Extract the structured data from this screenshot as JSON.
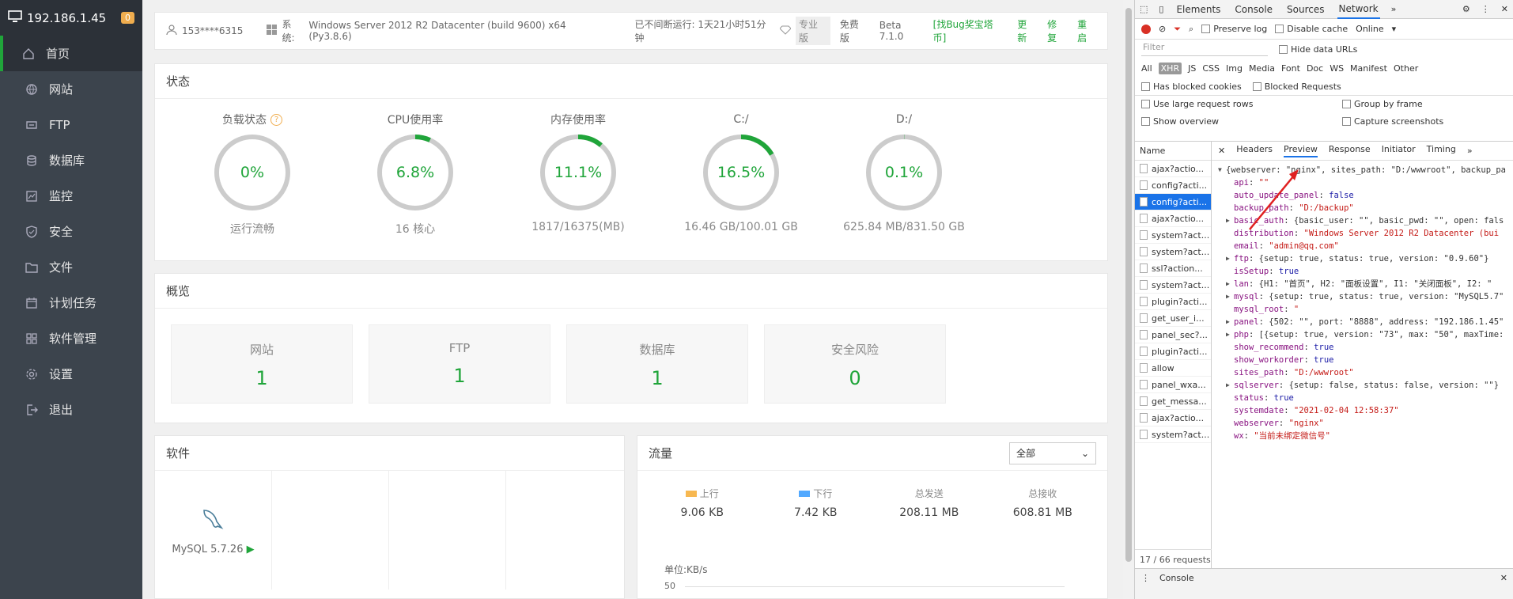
{
  "sidebar": {
    "ip": "192.186.1.45",
    "badge": "0",
    "items": [
      {
        "label": "首页",
        "icon": "home-icon"
      },
      {
        "label": "网站",
        "icon": "globe-icon"
      },
      {
        "label": "FTP",
        "icon": "ftp-icon"
      },
      {
        "label": "数据库",
        "icon": "database-icon"
      },
      {
        "label": "监控",
        "icon": "monitor-icon"
      },
      {
        "label": "安全",
        "icon": "shield-icon"
      },
      {
        "label": "文件",
        "icon": "folder-icon"
      },
      {
        "label": "计划任务",
        "icon": "calendar-icon"
      },
      {
        "label": "软件管理",
        "icon": "apps-icon"
      },
      {
        "label": "设置",
        "icon": "gear-icon"
      },
      {
        "label": "退出",
        "icon": "logout-icon"
      }
    ]
  },
  "topbar": {
    "user": "153****6315",
    "system_label": "系统:",
    "system": "Windows Server 2012 R2 Datacenter (build 9600) x64 (Py3.8.6)",
    "uptime": "已不间断运行: 1天21小时51分钟",
    "pro": "专业版",
    "free": "免费版",
    "version": "Beta 7.1.0",
    "bug": "[找Bug奖宝塔币]",
    "update": "更新",
    "repair": "修复",
    "restart": "重启"
  },
  "status": {
    "title": "状态",
    "gauges": [
      {
        "title": "负载状态",
        "value": "0%",
        "sub": "运行流畅",
        "pct": 0,
        "help": "?"
      },
      {
        "title": "CPU使用率",
        "value": "6.8%",
        "sub": "16 核心",
        "pct": 6.8
      },
      {
        "title": "内存使用率",
        "value": "11.1%",
        "sub": "1817/16375(MB)",
        "pct": 11.1
      },
      {
        "title": "C:/",
        "value": "16.5%",
        "sub": "16.46 GB/100.01 GB",
        "pct": 16.5
      },
      {
        "title": "D:/",
        "value": "0.1%",
        "sub": "625.84 MB/831.50 GB",
        "pct": 0.1
      }
    ],
    "color": "#20a53a"
  },
  "overview": {
    "title": "概览",
    "boxes": [
      {
        "label": "网站",
        "value": "1"
      },
      {
        "label": "FTP",
        "value": "1"
      },
      {
        "label": "数据库",
        "value": "1"
      },
      {
        "label": "安全风险",
        "value": "0"
      }
    ]
  },
  "software": {
    "title": "软件",
    "items": [
      {
        "name": "MySQL 5.7.26"
      }
    ]
  },
  "traffic": {
    "title": "流量",
    "select": "全部",
    "stats": [
      {
        "label": "上行",
        "value": "9.06 KB",
        "color": "#f7b851"
      },
      {
        "label": "下行",
        "value": "7.42 KB",
        "color": "#52a9ff"
      },
      {
        "label": "总发送",
        "value": "208.11 MB"
      },
      {
        "label": "总接收",
        "value": "608.81 MB"
      }
    ],
    "unit": "单位:KB/s",
    "ytick": "50"
  },
  "devtools": {
    "tabs": [
      "Elements",
      "Console",
      "Sources",
      "Network"
    ],
    "preserve": "Preserve log",
    "disable_cache": "Disable cache",
    "online": "Online",
    "filter_placeholder": "Filter",
    "hide_data": "Hide data URLs",
    "types": [
      "All",
      "XHR",
      "JS",
      "CSS",
      "Img",
      "Media",
      "Font",
      "Doc",
      "WS",
      "Manifest",
      "Other"
    ],
    "blocked_cookies": "Has blocked cookies",
    "blocked_requests": "Blocked Requests",
    "large_rows": "Use large request rows",
    "group_frame": "Group by frame",
    "overview": "Show overview",
    "capture": "Capture screenshots",
    "name_header": "Name",
    "names": [
      "ajax?actio...",
      "config?acti...",
      "config?acti...",
      "ajax?actio...",
      "system?act...",
      "system?act...",
      "ssl?action...",
      "system?act...",
      "plugin?acti...",
      "get_user_i...",
      "panel_sec?...",
      "plugin?acti...",
      "allow",
      "panel_wxa...",
      "get_messa...",
      "ajax?actio...",
      "system?act..."
    ],
    "requests_footer": "17 / 66 requests",
    "preview_tabs": [
      "Headers",
      "Preview",
      "Response",
      "Initiator",
      "Timing"
    ],
    "console_tab": "Console"
  },
  "json_lines": [
    {
      "t": "▼",
      "txt": "{webserver: \"nginx\", sites_path: \"D:/wwwroot\", backup_pa"
    },
    {
      "k": "api",
      "v": "\"\"",
      "c": "js"
    },
    {
      "k": "auto_update_panel",
      "v": "false",
      "c": "jb"
    },
    {
      "k": "backup_path",
      "v": "\"D:/backup\"",
      "c": "js"
    },
    {
      "t": "▶",
      "k": "basic_auth",
      "v": "{basic_user: \"\", basic_pwd: \"\", open: fals",
      "c": "plain"
    },
    {
      "k": "distribution",
      "v": "\"Windows Server 2012 R2 Datacenter (bui",
      "c": "js"
    },
    {
      "k": "email",
      "v": "\"admin@qq.com\"",
      "c": "js"
    },
    {
      "t": "▶",
      "k": "ftp",
      "v": "{setup: true, status: true, version: \"0.9.60\"}",
      "c": "plain"
    },
    {
      "k": "isSetup",
      "v": "true",
      "c": "jb"
    },
    {
      "t": "▶",
      "k": "lan",
      "v": "{H1: \"首页\", H2: \"面板设置\", I1: \"关闭面板\", I2: \"",
      "c": "plain"
    },
    {
      "t": "▶",
      "k": "mysql",
      "v": "{setup: true, status: true, version: \"MySQL5.7\"",
      "c": "plain"
    },
    {
      "k": "mysql_root",
      "v": "\"",
      "c": "js"
    },
    {
      "t": "▶",
      "k": "panel",
      "v": "{502: \"\", port: \"8888\", address: \"192.186.1.45\"",
      "c": "plain"
    },
    {
      "t": "▶",
      "k": "php",
      "v": "[{setup: true, version: \"73\", max: \"50\", maxTime:",
      "c": "plain"
    },
    {
      "k": "show_recommend",
      "v": "true",
      "c": "jb"
    },
    {
      "k": "show_workorder",
      "v": "true",
      "c": "jb"
    },
    {
      "k": "sites_path",
      "v": "\"D:/wwwroot\"",
      "c": "js"
    },
    {
      "t": "▶",
      "k": "sqlserver",
      "v": "{setup: false, status: false, version: \"\"}",
      "c": "plain"
    },
    {
      "k": "status",
      "v": "true",
      "c": "jb"
    },
    {
      "k": "systemdate",
      "v": "\"2021-02-04 12:58:37\"",
      "c": "js"
    },
    {
      "k": "webserver",
      "v": "\"nginx\"",
      "c": "js"
    },
    {
      "k": "wx",
      "v": "\"当前未绑定微信号\"",
      "c": "js"
    }
  ]
}
